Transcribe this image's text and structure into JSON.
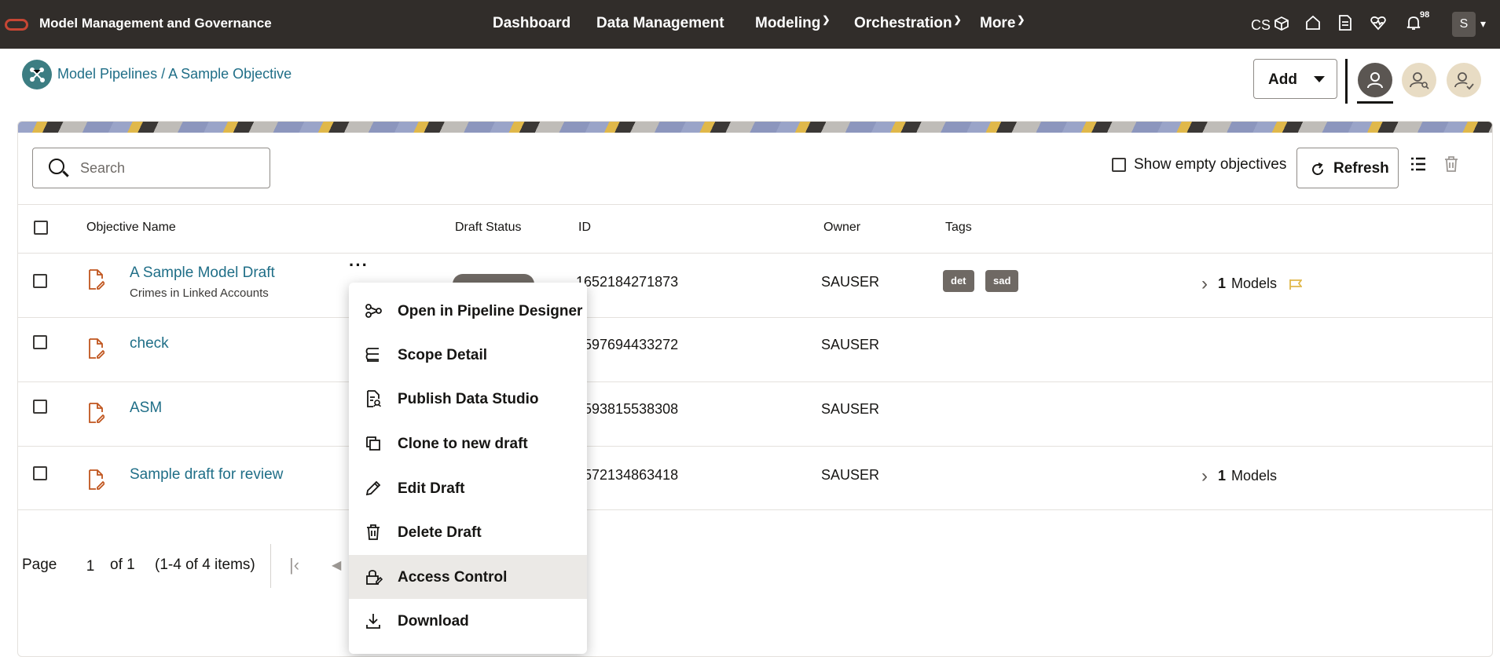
{
  "app": {
    "title": "Model Management and Governance"
  },
  "nav": {
    "dashboard": "Dashboard",
    "data_management": "Data Management",
    "modeling": "Modeling",
    "orchestration": "Orchestration",
    "more": "More"
  },
  "top_right": {
    "cs": "CS",
    "notifications_count": "98",
    "user_initial": "S"
  },
  "breadcrumb": {
    "root": "Model Pipelines",
    "separator": " / ",
    "current": "A Sample Objective"
  },
  "header": {
    "add_label": "Add"
  },
  "toolbar": {
    "search_placeholder": "Search",
    "show_empty_label": "Show empty objectives",
    "refresh_label": "Refresh"
  },
  "table": {
    "headers": {
      "name": "Objective Name",
      "draft_status": "Draft Status",
      "id": "ID",
      "owner": "Owner",
      "tags": "Tags"
    },
    "rows": [
      {
        "name": "A Sample Model Draft",
        "subtitle": "Crimes in Linked Accounts",
        "id": "1652184271873",
        "owner": "SAUSER",
        "tags": [
          "det",
          "sad"
        ],
        "models_count": "1",
        "models_label": "Models"
      },
      {
        "name": "check",
        "subtitle": "",
        "id": "1597694433272",
        "owner": "SAUSER",
        "tags": [],
        "models_count": "",
        "models_label": ""
      },
      {
        "name": "ASM",
        "subtitle": "",
        "id": "1593815538308",
        "owner": "SAUSER",
        "tags": [],
        "models_count": "",
        "models_label": ""
      },
      {
        "name": "Sample draft for review",
        "subtitle": "",
        "id": "1572134863418",
        "owner": "SAUSER",
        "tags": [],
        "models_count": "1",
        "models_label": "Models"
      }
    ]
  },
  "pager": {
    "page_label": "Page",
    "page_value": "1",
    "of_label": "of 1",
    "items_label": "(1-4 of 4 items)"
  },
  "context_menu": {
    "items": [
      {
        "label": "Open in Pipeline Designer",
        "icon": "pipeline-icon"
      },
      {
        "label": "Scope Detail",
        "icon": "scope-icon"
      },
      {
        "label": "Publish Data Studio",
        "icon": "publish-icon"
      },
      {
        "label": "Clone to new draft",
        "icon": "clone-icon"
      },
      {
        "label": "Edit Draft",
        "icon": "pencil-icon"
      },
      {
        "label": "Delete Draft",
        "icon": "trash-icon"
      },
      {
        "label": "Access Control",
        "icon": "lock-icon"
      },
      {
        "label": "Download",
        "icon": "download-icon"
      }
    ],
    "highlighted": "Access Control"
  },
  "colors": {
    "navbar": "#312d2a",
    "link": "#1f6e87",
    "tag": "#6f6964",
    "accent_icon": "#c0551e",
    "flag": "#e0b84a"
  }
}
